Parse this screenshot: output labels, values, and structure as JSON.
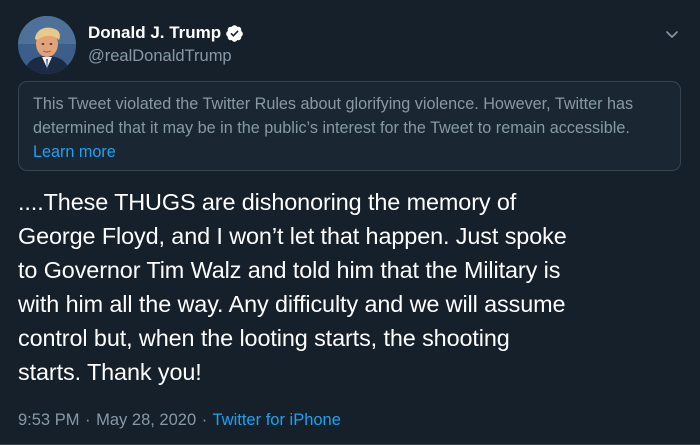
{
  "author": {
    "display_name": "Donald J. Trump",
    "handle": "@realDonaldTrump",
    "verified": true,
    "avatar": "profile-photo"
  },
  "notice": {
    "text": "This Tweet violated the Twitter Rules about glorifying violence. However, Twitter has determined that it may be in the public’s interest for the Tweet to remain accessible. ",
    "link_label": "Learn more"
  },
  "tweet": {
    "lines": [
      "....These THUGS are dishonoring the memory of",
      "George Floyd, and I won’t let that happen. Just spoke",
      "to Governor Tim Walz and told him that the Military is",
      "with him all the way. Any difficulty and we will assume",
      "control but, when the looting starts, the shooting",
      "starts. Thank you!"
    ]
  },
  "meta": {
    "time": "9:53 PM",
    "date": "May 28, 2020",
    "separator": "·",
    "source": "Twitter for iPhone"
  },
  "icons": {
    "verified": "verified-badge-icon",
    "caret": "chevron-down-icon"
  },
  "colors": {
    "background": "#15202b",
    "notice_background": "#1a2733",
    "secondary_text": "#8899a6",
    "accent": "#1da1f2",
    "primary_text": "#ffffff"
  }
}
